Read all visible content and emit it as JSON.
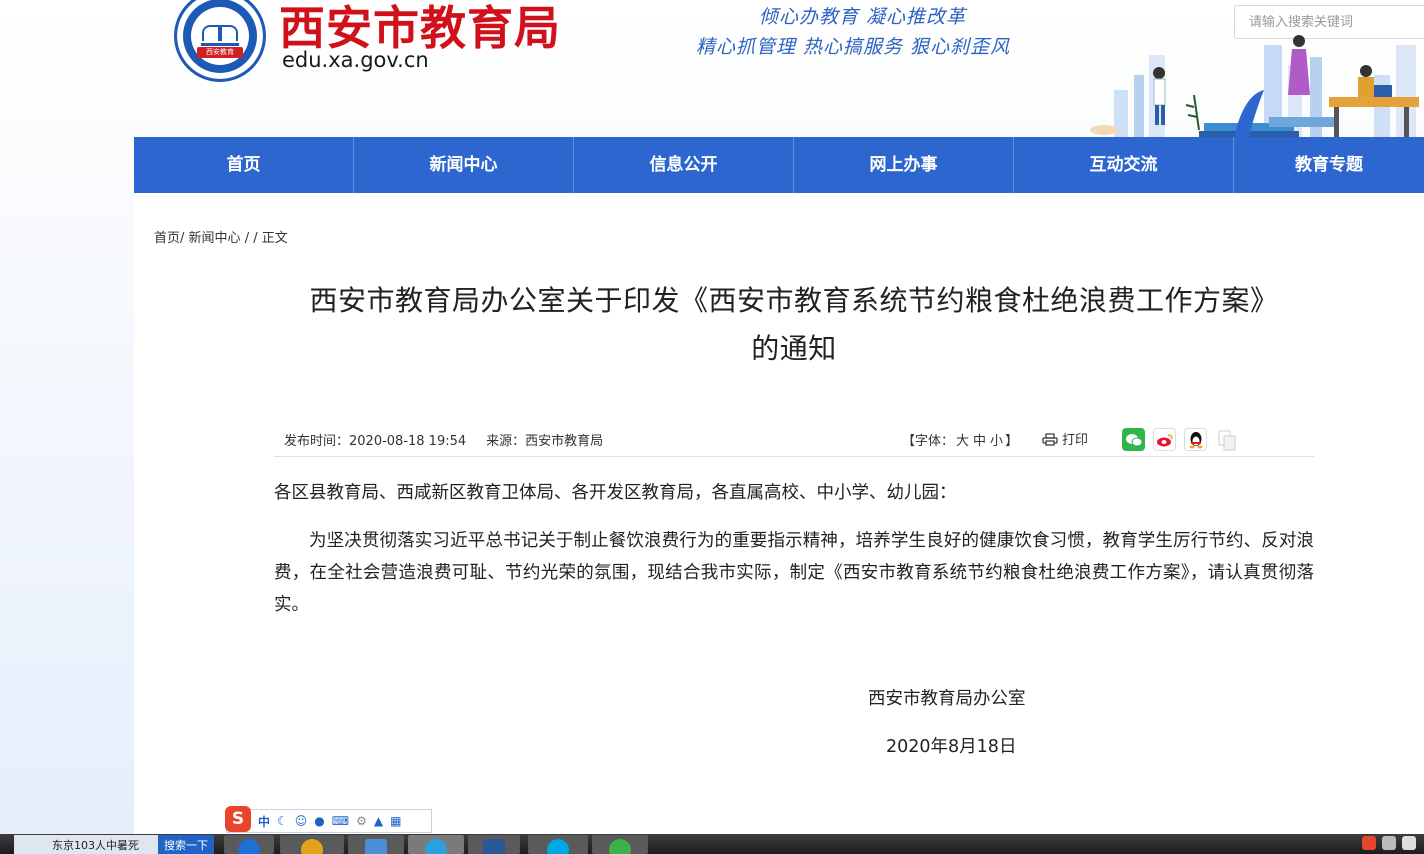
{
  "header": {
    "site_title": "西安市教育局",
    "site_url": "edu.xa.gov.cn",
    "logo_ribbon": "西安教育",
    "slogan_line1": "倾心办教育  凝心推改革",
    "slogan_line2": "精心抓管理  热心搞服务  狠心刹歪风",
    "search_placeholder": "请输入搜索关键词"
  },
  "nav": {
    "items": [
      "首页",
      "新闻中心",
      "信息公开",
      "网上办事",
      "互动交流",
      "教育专题"
    ]
  },
  "breadcrumb": {
    "home": "首页/",
    "news": "新闻中心",
    "sep": "/ /",
    "current": "正文"
  },
  "article": {
    "title_line1": "西安市教育局办公室关于印发《西安市教育系统节约粮食杜绝浪费工作方案》",
    "title_line2": "的通知",
    "publish_time": "发布时间：2020-08-18 19:54",
    "source": "来源：西安市教育局",
    "font_size_prefix": "【字体：",
    "font_size_large": "大",
    "font_size_medium": "中",
    "font_size_small": "小",
    "font_size_suffix": "】",
    "print_label": "打印",
    "salutation": "各区县教育局、西咸新区教育卫体局、各开发区教育局，各直属高校、中小学、幼儿园：",
    "paragraph1": "为坚决贯彻落实习近平总书记关于制止餐饮浪费行为的重要指示精神，培养学生良好的健康饮食习惯，教育学生厉行节约、反对浪费，在全社会营造浪费可耻、节约光荣的氛围，现结合我市实际，制定《西安市教育系统节约粮食杜绝浪费工作方案》，请认真贯彻落实。",
    "signature_org": "西安市教育局办公室",
    "signature_date": "2020年8月18日"
  },
  "ime": {
    "logo": "S",
    "mode": "中"
  },
  "taskbar": {
    "task_label": "东京103人中暑死",
    "search_label": "搜索一下"
  },
  "colors": {
    "brand_red": "#d0101a",
    "nav_blue": "#2d66cf",
    "slogan_blue": "#2c63c2"
  }
}
